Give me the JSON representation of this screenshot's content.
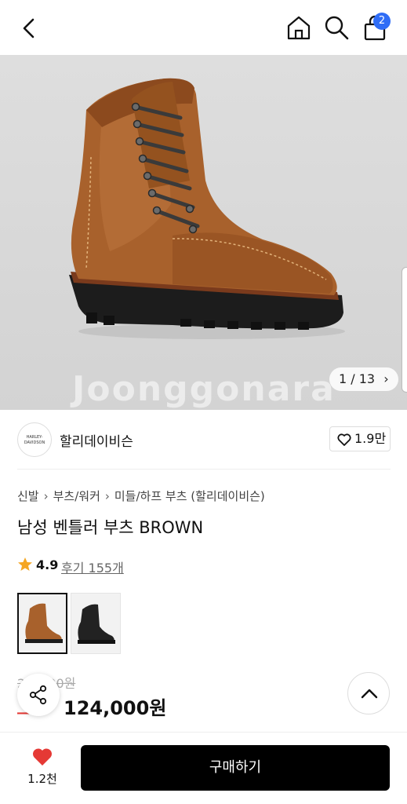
{
  "header": {
    "icons": [
      "back-icon",
      "home-icon",
      "search-icon",
      "shopping-bag-icon"
    ],
    "cart_count": "2"
  },
  "gallery": {
    "counter": "1 / 13",
    "watermark": "Joonggonara"
  },
  "brand": {
    "logo_text": "HARLEY-DAVIDSON",
    "name": "할리데이비슨",
    "likes": "1.9만"
  },
  "breadcrumb": [
    "신발",
    "부츠/워커",
    "미들/하프 부츠 (할리데이비슨)"
  ],
  "product": {
    "title": "남성 벤틀러 부츠 BROWN",
    "rating": "4.9",
    "reviews": "후기 155개",
    "original_price": "2__,_90원",
    "discount": "__%",
    "price": "124,000원"
  },
  "colors": {
    "accent": "#2f6df6",
    "sale": "#e53935",
    "wish": "#e53935",
    "star": "#f5a623"
  },
  "bottom_bar": {
    "wish_count": "1.2천",
    "buy_label": "구매하기"
  }
}
